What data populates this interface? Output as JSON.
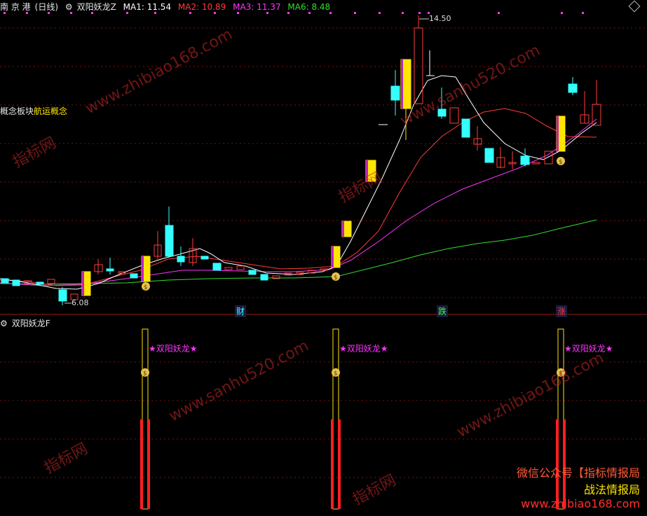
{
  "header": {
    "stock": "南 京 港",
    "period": "(日线)",
    "indicator": "双阳妖龙Z",
    "ma1_label": "MA1: 11.54",
    "ma2_label": "MA2: 10.89",
    "ma3_label": "MA3: 11.37",
    "ma6_label": "MA6: 8.48"
  },
  "concept": {
    "prefix": "概念板块",
    "value": "航运概念"
  },
  "price_labels": {
    "high": "14.50",
    "low": "6.08"
  },
  "markers": {
    "cai": "财",
    "die": "跌",
    "zhang": "涨"
  },
  "lower_panel": {
    "title": "双阳妖龙F",
    "signal_label": "★双阳妖龙★"
  },
  "promo": {
    "line1": "微信公众号【指标情报局",
    "line2": "战法情报局",
    "line3": "www.zhibiao168.com"
  },
  "watermarks": {
    "w1": "www.zhibiao168.com",
    "w2": "www.sanhu520.com",
    "w3": "指标网"
  },
  "colors": {
    "up": "#ff3b3b",
    "down": "#33ffff",
    "ma1": "#ffffff",
    "ma2": "#ff3b3b",
    "ma3": "#ff35ff",
    "ma6": "#33dd33",
    "signal": "#ffe600",
    "background": "#000000"
  }
}
